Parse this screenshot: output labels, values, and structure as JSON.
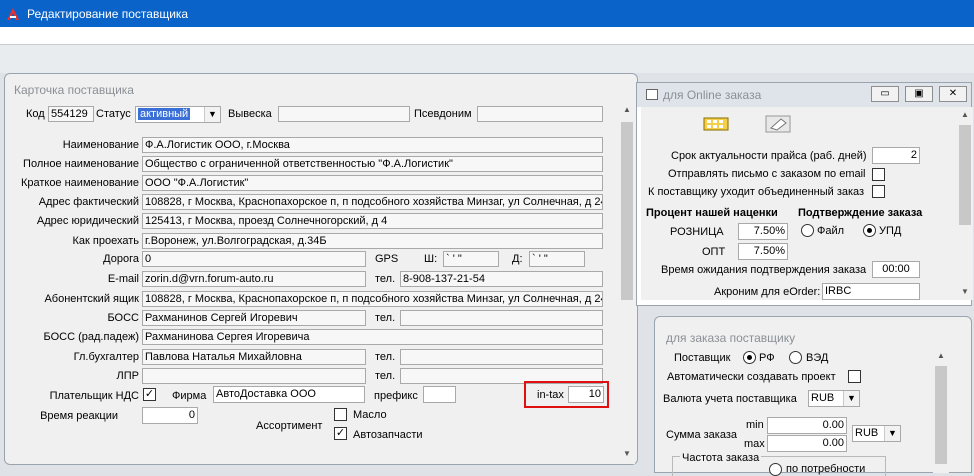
{
  "window": {
    "title": "Редактирование поставщика"
  },
  "card": {
    "title": "Карточка поставщика",
    "code_label": "Код",
    "code": "554129",
    "status_label": "Статус",
    "status": "активный",
    "sign_label": "Вывеска",
    "sign": "",
    "alias_label": "Псевдоним",
    "alias": "",
    "name_label": "Наименование",
    "name": "Ф.А.Логистик ООО, г.Москва",
    "full_name_label": "Полное наименование",
    "full_name": "Общество с ограниченной ответственностью \"Ф.А.Логистик\"",
    "short_name_label": "Краткое наименование",
    "short_name": "ООО \"Ф.А.Логистик\"",
    "actual_address_label": "Адрес фактический",
    "actual_address": "108828, г Москва, Краснопахорское п, п подсобного хозяйства Минзаг, ул Солнечная, д 24",
    "legal_address_label": "Адрес юридический",
    "legal_address": "125413, г Москва, проезд Солнечногорский, д 4",
    "directions_label": "Как проехать",
    "directions": "г.Воронеж, ул.Волгоградская, д.34Б",
    "road_label": "Дорога",
    "road": "0",
    "gps_label": "GPS",
    "lat_label": "Ш:",
    "lat": "` ' \"",
    "lon_label": "Д:",
    "lon": "` ' \"",
    "email_label": "E-mail",
    "email": "zorin.d@vrn.forum-auto.ru",
    "phone_label": "тел.",
    "phone": "8-908-137-21-54",
    "mailbox_label": "Абонентский ящик",
    "mailbox": "108828, г Москва, Краснопахорское п, п подсобного хозяйства Минзаг, ул Солнечная, д 24",
    "boss_label": "БОСС",
    "boss": "Рахманинов Сергей Игоревич",
    "boss_phone_label": "тел.",
    "boss_phone": "",
    "boss_gen_label": "БОСС (рад.падеж)",
    "boss_gen": "Рахманинова Сергея Игоревича",
    "accountant_label": "Гл.бухгалтер",
    "accountant": "Павлова Наталья Михайловна",
    "accountant_phone_label": "тел.",
    "accountant_phone": "",
    "lpr_label": "ЛПР",
    "lpr": "",
    "lpr_phone_label": "тел.",
    "lpr_phone": "",
    "vat_label": "Плательщик НДС",
    "vat_check": "✓",
    "firm_label": "Фирма",
    "firm": "АвтоДоставка ООО",
    "prefix_label": "префикс",
    "prefix": "",
    "intax_label": "in-tax",
    "intax": "10",
    "reaction_label": "Время реакции",
    "reaction": "0",
    "assortment_label": "Ассортимент",
    "assort_oil_label": "Масло",
    "assort_oil_check": "",
    "assort_parts_label": "Автозапчасти",
    "assort_parts_check": "✓"
  },
  "online": {
    "title": "для Online заказа",
    "price_days_label": "Срок актуальности прайса (раб. дней)",
    "price_days": "2",
    "send_email_label": "Отправлять письмо с заказом по email",
    "combined_label": "К поставщику уходит объединенный заказ",
    "markup_title": "Процент нашей наценки",
    "confirm_title": "Подтверждение заказа",
    "retail_label": "РОЗНИЦА",
    "retail": "7.50%",
    "wholesale_label": "ОПТ",
    "wholesale": "7.50%",
    "confirm_file": "Файл",
    "confirm_upd": "УПД",
    "wait_label": "Время ожидания подтверждения заказа",
    "wait": "00:00",
    "acronym_label": "Акроним для eOrder:",
    "acronym": "IRBC",
    "btn_minimize": "▭",
    "btn_restore": "▣",
    "btn_close": "✕"
  },
  "supplier_order": {
    "title": "для заказа поставщику",
    "supplier_label": "Поставщик",
    "rf": "РФ",
    "ved": "ВЭД",
    "auto_project_label": "Автоматически создавать проект",
    "currency_label": "Валюта учета поставщика",
    "currency": "RUB",
    "sum_label": "Сумма заказа",
    "min_label": "min",
    "min": "0.00",
    "max_label": "max",
    "max": "0.00",
    "sum_currency": "RUB",
    "frequency_label": "Частота заказа",
    "on_demand": "по потребности"
  },
  "colors": {
    "titlebar": "#0a63c9",
    "highlight": "#e01010",
    "status_bg": "#3a6fd8"
  }
}
